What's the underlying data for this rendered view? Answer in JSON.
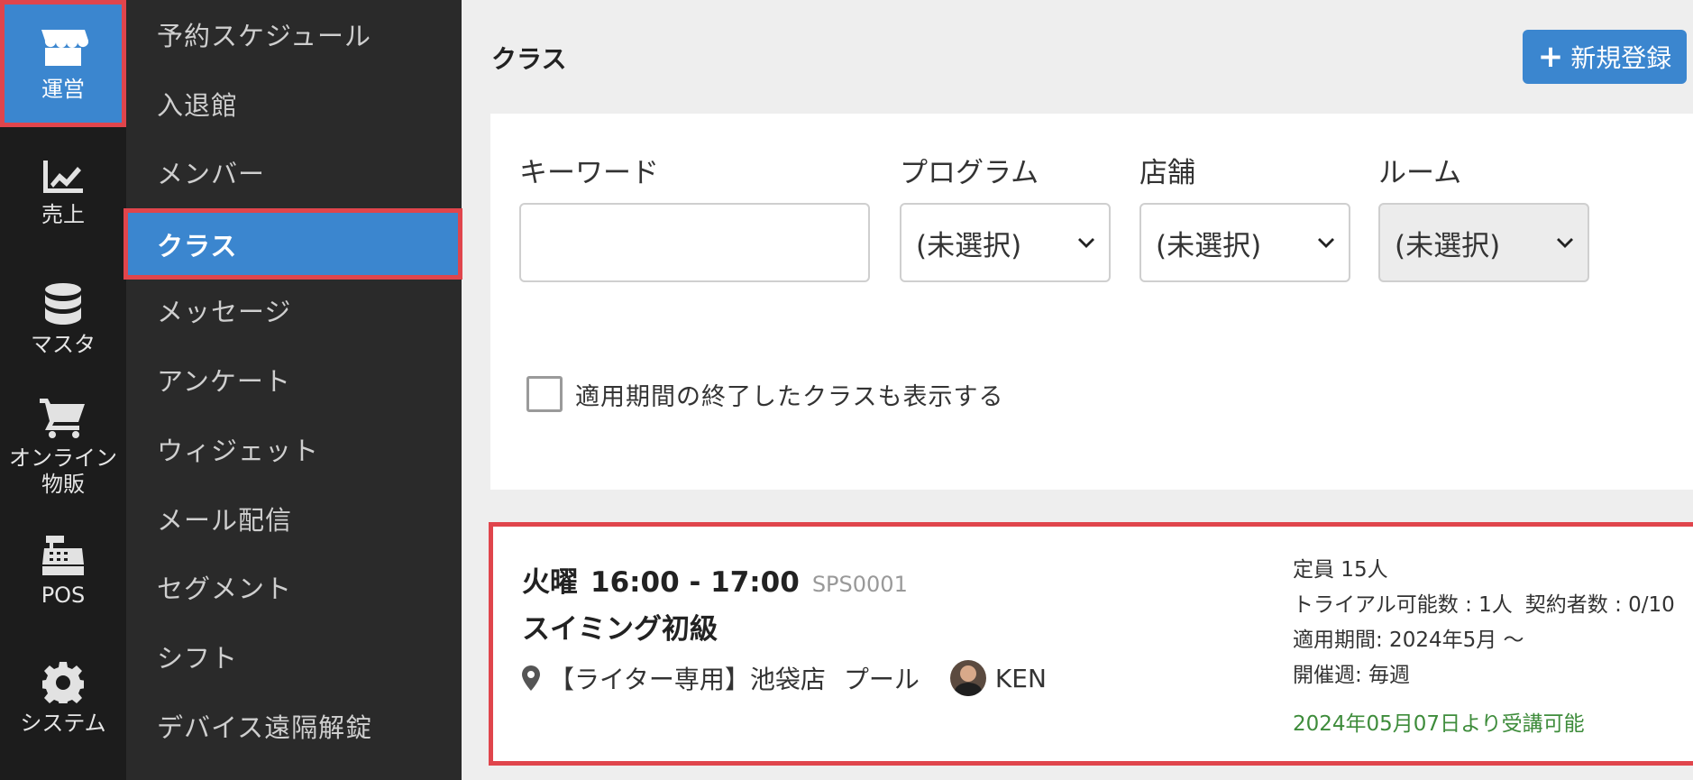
{
  "rail": [
    {
      "label": "運営",
      "icon": "store-icon"
    },
    {
      "label": "売上",
      "icon": "chart-line-icon"
    },
    {
      "label": "マスタ",
      "icon": "database-icon"
    },
    {
      "label": "オンライン\n物販",
      "label_line1": "オンライン",
      "label_line2": "物販",
      "icon": "cart-icon"
    },
    {
      "label": "POS",
      "icon": "cash-register-icon"
    },
    {
      "label": "システム",
      "icon": "gear-icon"
    }
  ],
  "subnav": [
    "予約スケジュール",
    "入退館",
    "メンバー",
    "クラス",
    "メッセージ",
    "アンケート",
    "ウィジェット",
    "メール配信",
    "セグメント",
    "シフト",
    "デバイス遠隔解錠"
  ],
  "page": {
    "title": "クラス",
    "new_button": "新規登録"
  },
  "filters": {
    "keyword_label": "キーワード",
    "keyword_value": "",
    "program_label": "プログラム",
    "program_value": "(未選択)",
    "store_label": "店舗",
    "store_value": "(未選択)",
    "room_label": "ルーム",
    "room_value": "(未選択)",
    "show_ended_label": "適用期間の終了したクラスも表示する",
    "show_ended_checked": false
  },
  "class_card": {
    "day": "火曜",
    "time": "16:00 - 17:00",
    "code": "SPS0001",
    "name": "スイミング初級",
    "location": "【ライター専用】池袋店",
    "room": "プール",
    "instructor": "KEN",
    "capacity": "定員 15人",
    "trial": "トライアル可能数 : 1人",
    "contracts": "契約者数 : 0/10",
    "period": "適用期間: 2024年5月 〜",
    "frequency": "開催週: 毎週",
    "available_from": "2024年05月07日より受講可能"
  },
  "colors": {
    "accent": "#3b86cf",
    "highlight_border": "#e0454c",
    "rail_bg": "#1c1c1c",
    "subnav_bg": "#2a2a2a",
    "available_text": "#3e8c3b"
  }
}
